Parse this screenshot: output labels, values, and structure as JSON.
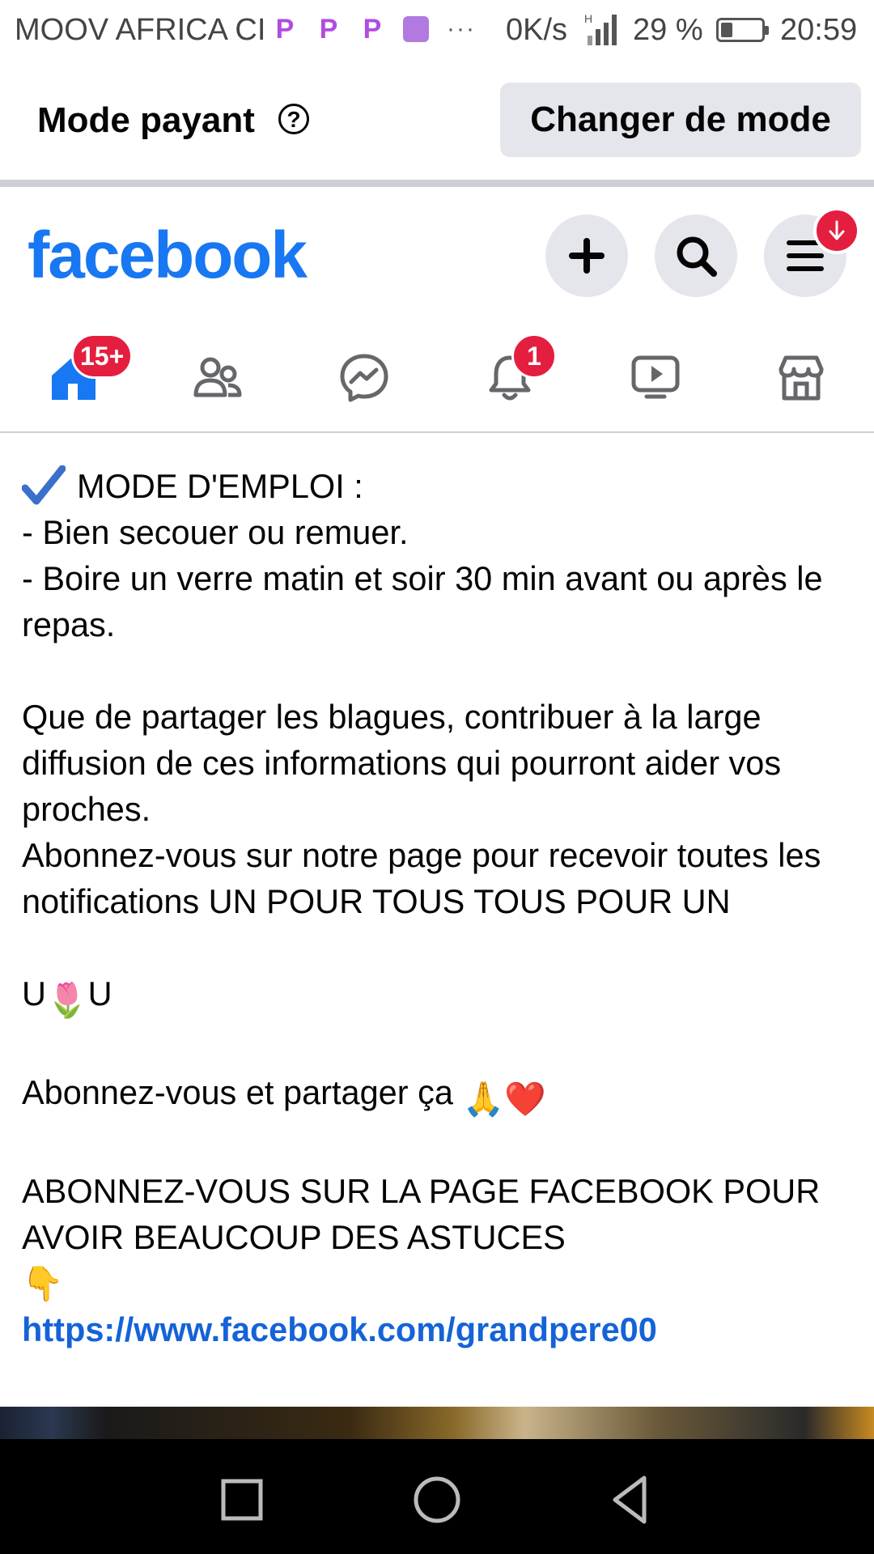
{
  "status_bar": {
    "carrier": "MOOV AFRICA CI",
    "app_icons": [
      "app-p-icon",
      "app-p-icon",
      "app-p-icon",
      "gallery-icon"
    ],
    "more": "···",
    "net_speed": "0K/s",
    "signal_label": "H",
    "battery_pct": "29 %",
    "battery_level": 0.29,
    "time": "20:59"
  },
  "mode_bar": {
    "label": "Mode payant",
    "help": "?",
    "button": "Changer de mode"
  },
  "header": {
    "logo": "facebook",
    "brand_color": "#1877f2",
    "buttons": [
      "plus-icon",
      "search-icon",
      "menu-icon"
    ]
  },
  "tabs": [
    {
      "name": "home",
      "icon": "home-icon",
      "badge": "15+",
      "active": true
    },
    {
      "name": "friends",
      "icon": "friends-icon",
      "badge": ""
    },
    {
      "name": "messenger",
      "icon": "messenger-icon",
      "badge": ""
    },
    {
      "name": "notifications",
      "icon": "bell-icon",
      "badge": "1"
    },
    {
      "name": "watch",
      "icon": "video-icon",
      "badge": ""
    },
    {
      "name": "marketplace",
      "icon": "store-icon",
      "badge": ""
    }
  ],
  "post": {
    "line1": "MODE D'EMPLOI :",
    "line2": "- Bien secouer ou remuer.",
    "line3": "- Boire un verre matin et soir 30 min avant ou après le repas.",
    "para1": "Que de partager les blagues, contribuer à la large diffusion de ces informations qui pourront aider vos proches.",
    "para2": "Abonnez-vous sur notre page pour recevoir toutes les notifications UN POUR TOUS TOUS POUR UN",
    "u_left": "U",
    "tulip": "🌷",
    "u_right": "U",
    "share_text": "Abonnez-vous et partager ça",
    "share_emojis": "🙏❤️",
    "caps": "ABONNEZ-VOUS SUR LA PAGE FACEBOOK POUR AVOIR BEAUCOUP DES ASTUCES",
    "pointer": "👇",
    "link": "https://www.facebook.com/grandpere00"
  },
  "colors": {
    "badge": "#e41e3f",
    "link": "#1463d8",
    "button_bg": "#e4e6eb"
  }
}
